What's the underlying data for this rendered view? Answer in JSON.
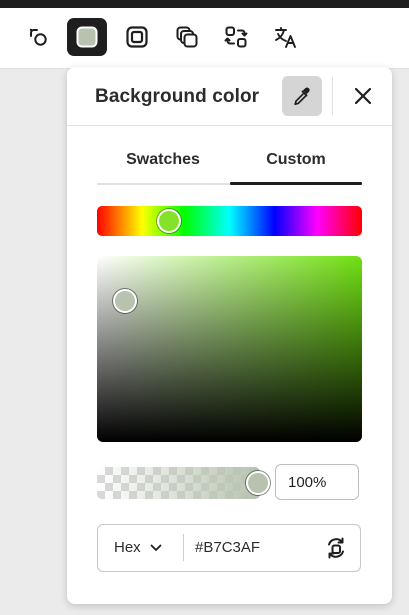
{
  "toolbar": {
    "tools": [
      {
        "icon": "shape-link-icon",
        "active": false
      },
      {
        "icon": "background-color-icon",
        "active": true
      },
      {
        "icon": "border-frame-icon",
        "active": false
      },
      {
        "icon": "layers-copy-icon",
        "active": false
      },
      {
        "icon": "replace-icon",
        "active": false
      },
      {
        "icon": "translate-icon",
        "active": false
      }
    ]
  },
  "panel": {
    "title": "Background color",
    "tabs": [
      {
        "label": "Swatches",
        "selected": false
      },
      {
        "label": "Custom",
        "selected": true
      }
    ],
    "color": {
      "hue_color": "#85e22a",
      "selected_hex": "#B7C3AF",
      "opacity_text": "100%",
      "format": "Hex",
      "hex_text": "#B7C3AF"
    }
  },
  "colors": {
    "accent_dark": "#1e1e1e",
    "selected": "#b7c3af",
    "eyedropper_bg": "#d5d5d5"
  }
}
